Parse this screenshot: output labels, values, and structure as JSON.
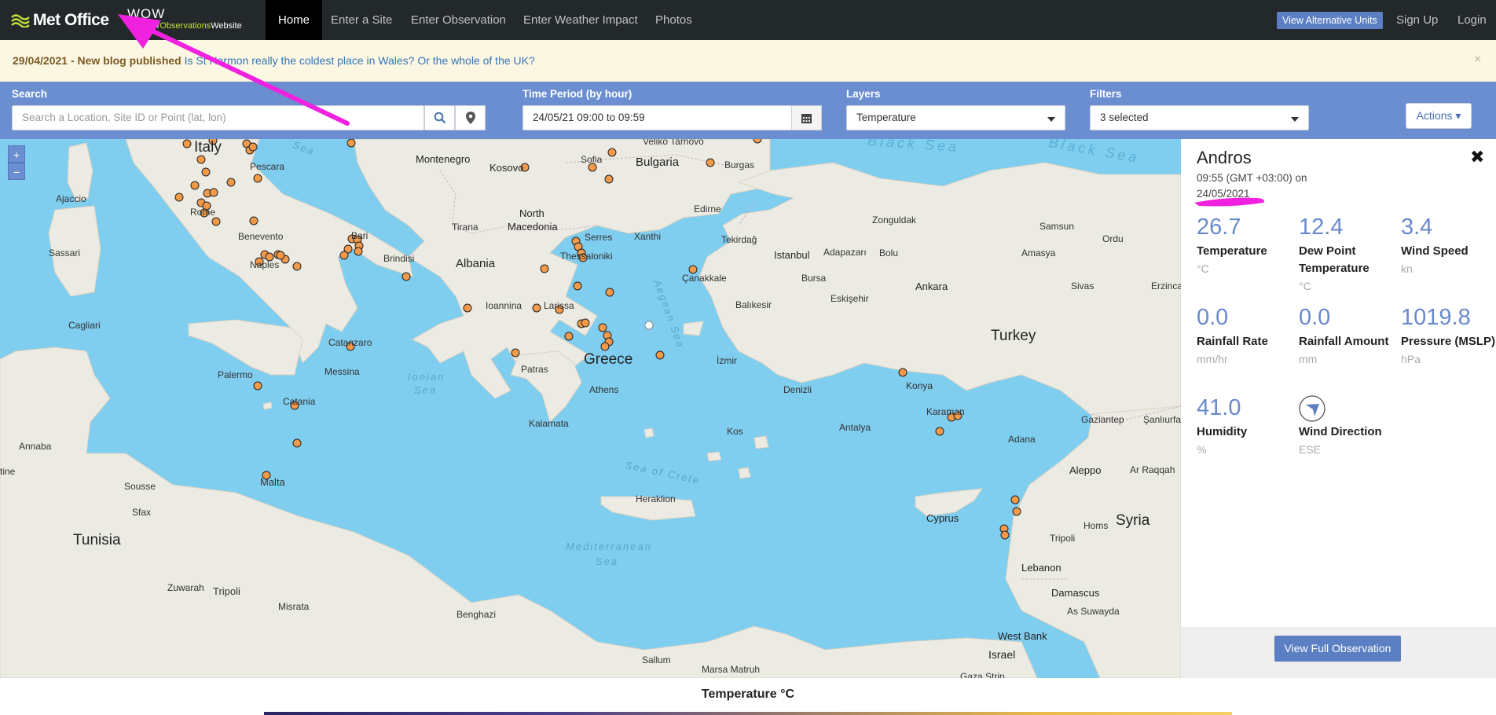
{
  "nav": {
    "brand": "Met Office",
    "wow_main": "WOW",
    "wow_sub_a": "Weather",
    "wow_sub_b": "Observations",
    "wow_sub_c": "Website",
    "items": [
      {
        "label": "Home"
      },
      {
        "label": "Enter a Site"
      },
      {
        "label": "Enter Observation"
      },
      {
        "label": "Enter Weather Impact"
      },
      {
        "label": "Photos"
      }
    ],
    "alt_units": "View Alternative Units",
    "signup": "Sign Up",
    "login": "Login"
  },
  "banner": {
    "date": "29/04/2021 - New blog published",
    "link": "Is St Harmon really the coldest place in Wales? Or the whole of the UK?",
    "close": "×"
  },
  "toolbar": {
    "search_label": "Search",
    "search_placeholder": "Search a Location, Site ID or Point (lat, lon)",
    "time_label": "Time Period (by hour)",
    "time_value": "24/05/21 09:00 to 09:59",
    "layers_label": "Layers",
    "layers_value": "Temperature",
    "filters_label": "Filters",
    "filters_value": "3 selected",
    "actions": "Actions ▾"
  },
  "map": {
    "zoom_in": "+",
    "zoom_out": "−",
    "labels": {
      "italy": "Italy",
      "pescara": "Pescara",
      "ajaccio": "Ajaccio",
      "rome": "Rome",
      "sassari": "Sassari",
      "benevento": "Benevento",
      "naples": "Naples",
      "bari": "Bari",
      "brindisi": "Brindisi",
      "cagliari": "Cagliari",
      "catanzaro": "Catanzaro",
      "palermo": "Palermo",
      "messina": "Messina",
      "catania": "Catania",
      "malta": "Malta",
      "annaba": "Annaba",
      "sousse": "Sousse",
      "sfax": "Sfax",
      "tunisia": "Tunisia",
      "zuwarah": "Zuwarah",
      "tripoli": "Tripoli",
      "misrata": "Misrata",
      "benghazi": "Benghazi",
      "tine": "tine",
      "montenegro": "Montenegro",
      "kosovo": "Kosovo",
      "north_macedonia_1": "North",
      "north_macedonia_2": "Macedonia",
      "tirana": "Tirana",
      "albania": "Albania",
      "bulgaria": "Bulgaria",
      "sofia": "Sofia",
      "veliko": "Veliko Tarnovo",
      "burgas": "Burgas",
      "serres": "Serres",
      "xanthi": "Xanthi",
      "thessaloniki": "Thessaloniki",
      "ioannina": "Ioannina",
      "larissa": "Larissa",
      "greece": "Greece",
      "patras": "Patras",
      "athens": "Athens",
      "kalamata": "Kalamata",
      "heraklion": "Heraklion",
      "edirne": "Edirne",
      "tekirdag": "Tekirdağ",
      "istanbul": "Istanbul",
      "canakkale": "Çanakkale",
      "balikesir": "Balıkesir",
      "izmir": "İzmir",
      "denizli": "Denizli",
      "kos": "Kos",
      "zonguldak": "Zonguldak",
      "adapazari": "Adapazarı",
      "bolu": "Bolu",
      "bursa": "Bursa",
      "eskisehir": "Eskişehir",
      "ankara": "Ankara",
      "turkey": "Turkey",
      "konya": "Konya",
      "karaman": "Karaman",
      "antalya": "Antalya",
      "adana": "Adana",
      "samsun": "Samsun",
      "amasya": "Amasya",
      "ordu": "Ordu",
      "sivas": "Sivas",
      "erzincan": "Erzinca",
      "gaziantep": "Gaziantep",
      "sanliurfa": "Şanlıurfa",
      "aleppo": "Aleppo",
      "ar_raqqah": "Ar Raqqah",
      "syria": "Syria",
      "homs": "Homs",
      "tripoli_lb": "Tripoli",
      "lebanon": "Lebanon",
      "damascus": "Damascus",
      "as_suwayda": "As Suwayda",
      "west_bank": "West Bank",
      "israel": "Israel",
      "gaza": "Gaza Strip",
      "cyprus": "Cyprus",
      "salum": "Sallum",
      "marsa": "Marsa Matruh",
      "black_sea_1": "Black Sea",
      "black_sea_2": "Black Sea",
      "sea_top": "Sea",
      "ionian_1": "Ionian",
      "ionian_2": "Sea",
      "aegean": "Aegean Sea",
      "crete": "Sea of Crete",
      "med_1": "Mediterranean",
      "med_2": "Sea"
    }
  },
  "panel": {
    "station": "Andros",
    "time_line1": "09:55 (GMT +03:00) on",
    "time_line2": "24/05/2021",
    "close": "✖",
    "obs": [
      {
        "value": "26.7",
        "name": "Temperature",
        "unit": "°C"
      },
      {
        "value": "12.4",
        "name": "Dew Point Temperature",
        "unit": "°C"
      },
      {
        "value": "3.4",
        "name": "Wind Speed",
        "unit": "kn"
      },
      {
        "value": "0.0",
        "name": "Rainfall Rate",
        "unit": "mm/hr"
      },
      {
        "value": "0.0",
        "name": "Rainfall Amount",
        "unit": "mm"
      },
      {
        "value": "1019.8",
        "name": "Pressure (MSLP)",
        "unit": "hPa"
      },
      {
        "value": "41.0",
        "name": "Humidity",
        "unit": "%"
      },
      {
        "name": "Wind Direction",
        "unit": "ESE",
        "icon": "wind-direction-arrow-icon"
      }
    ],
    "view_full": "View Full Observation"
  },
  "legend": {
    "title": "Temperature °C"
  },
  "colors": {
    "nav_bg": "#23282b",
    "toolbar_bg": "#6a8ed0",
    "sea": "#7fcdef",
    "land": "#ecebe3",
    "marker_fill": "#f29a4a",
    "annotation": "#f022e0",
    "value_blue": "#6889cc"
  }
}
